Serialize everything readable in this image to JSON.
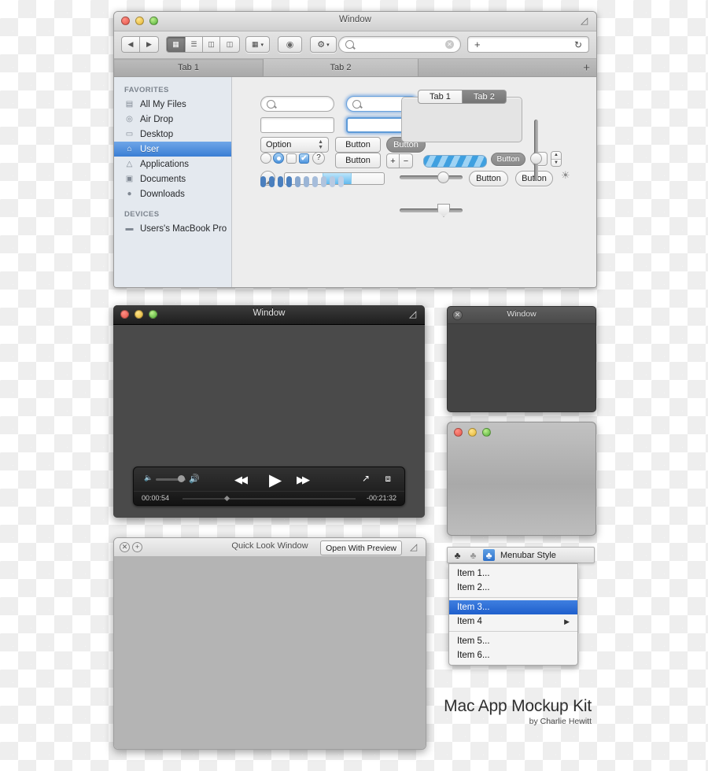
{
  "finder": {
    "title": "Window",
    "toolbar": {
      "back_label": "◀",
      "forward_label": "▶",
      "view_icon": "grid-view-icon",
      "view_list_icon": "list-view-icon",
      "view_column_icon": "column-view-icon",
      "view_cover_icon": "coverflow-view-icon",
      "arrange_label": "▒",
      "eye_label": "◉",
      "gear_label": "⚙",
      "dropdown_caret": "▾",
      "search_placeholder": "",
      "search_value": "",
      "url_value": "",
      "plus_label": "+",
      "reload_label": "↻"
    },
    "tabs": [
      {
        "label": "Tab 1",
        "active": true
      },
      {
        "label": "Tab 2",
        "active": false
      }
    ],
    "new_tab_label": "+",
    "sidebar": {
      "sections": [
        {
          "header": "FAVORITES",
          "items": [
            {
              "label": "All My Files",
              "icon": "all-files-icon",
              "glyph": "☷",
              "selected": false
            },
            {
              "label": "Air Drop",
              "icon": "airdrop-icon",
              "glyph": "◔",
              "selected": false
            },
            {
              "label": "Desktop",
              "icon": "desktop-icon",
              "glyph": "▭",
              "selected": false
            },
            {
              "label": "User",
              "icon": "home-icon",
              "glyph": "⌂",
              "selected": true
            },
            {
              "label": "Applications",
              "icon": "applications-icon",
              "glyph": "✈",
              "selected": false
            },
            {
              "label": "Documents",
              "icon": "documents-icon",
              "glyph": "☰",
              "selected": false
            },
            {
              "label": "Downloads",
              "icon": "downloads-icon",
              "glyph": "⬇",
              "selected": false
            }
          ]
        },
        {
          "header": "DEVICES",
          "items": [
            {
              "label": "Users's MacBook Pro",
              "icon": "laptop-icon",
              "glyph": "▬",
              "selected": false
            }
          ]
        }
      ]
    },
    "controls": {
      "search_plain_value": "",
      "search_focus_value": "",
      "text_plain_value": "",
      "text_focus_value": "",
      "popup_label": "Option",
      "popup_arrows": "↕",
      "button_normal_1": "Button",
      "button_dark": "Button",
      "button_normal_2": "Button",
      "help_label": "?",
      "stepper_plus": "+",
      "stepper_minus": "−",
      "stepper_up": "▲",
      "stepper_down": "▼",
      "disclosure_glyph": "◢",
      "button_round_1": "Button",
      "button_round_2": "Button",
      "button_up_arrow": "▲",
      "button_dark_2": "Button",
      "gear_spin_glyph": "☀",
      "tabview_tab_a": "Tab 1",
      "tabview_tab_b": "Tab 2",
      "checkbox_check": "✔",
      "dots_count": 10,
      "dots_active": 4,
      "level_fill_percent": 38
    }
  },
  "player": {
    "title": "Window",
    "fullscreen_icon": "fullscreen-icon",
    "volume_low_glyph": "🔈",
    "volume_high_glyph": "🔊",
    "rewind_glyph": "◀◀",
    "play_glyph": "▶",
    "forward_glyph": "▶▶",
    "share_glyph": "⬆",
    "expand_glyph": "⤡",
    "time_elapsed": "00:00:54",
    "time_remaining": "-00:21:32",
    "scrub_percent": 33
  },
  "dark_window": {
    "title": "Window",
    "close_glyph": "✕"
  },
  "gray_window": {
    "title": ""
  },
  "quicklook": {
    "title": "Quick Look Window",
    "close_glyph": "✕",
    "zoom_glyph": "+",
    "open_button": "Open With Preview",
    "fullscreen_icon": "fullscreen-icon"
  },
  "menubar": {
    "icons": [
      "extension-icon-dark",
      "extension-icon-gray",
      "extension-icon-selected"
    ],
    "icon_glyph": "♣",
    "label": "Menubar Style",
    "items": [
      {
        "label": "Item 1...",
        "selected": false,
        "submenu": false,
        "separator_after": false
      },
      {
        "label": "Item 2...",
        "selected": false,
        "submenu": false,
        "separator_after": true
      },
      {
        "label": "Item 3...",
        "selected": true,
        "submenu": false,
        "separator_after": false
      },
      {
        "label": "Item 4",
        "selected": false,
        "submenu": true,
        "separator_after": true
      },
      {
        "label": "Item 5...",
        "selected": false,
        "submenu": false,
        "separator_after": false
      },
      {
        "label": "Item 6...",
        "selected": false,
        "submenu": false,
        "separator_after": false
      }
    ],
    "submenu_arrow": "▶"
  },
  "footer": {
    "title": "Mac App Mockup Kit",
    "subtitle": "by Charlie Hewitt"
  }
}
